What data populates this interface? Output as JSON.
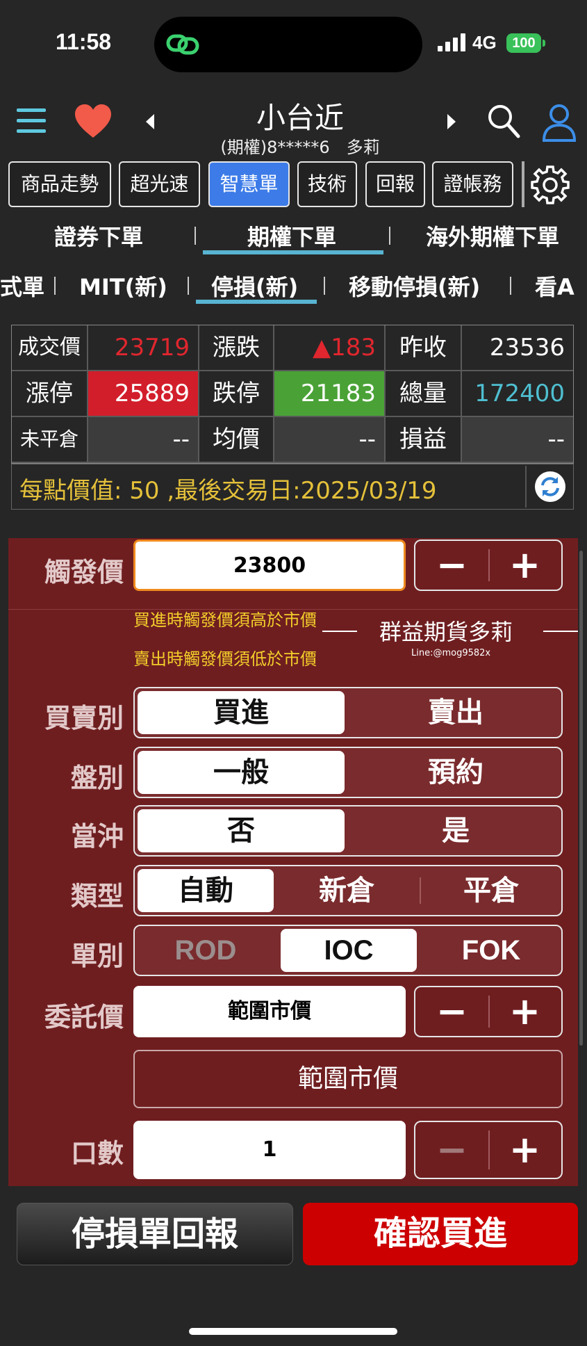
{
  "status": {
    "time": "11:58",
    "network": "4G",
    "battery": "100"
  },
  "header": {
    "title": "小台近",
    "subtitle": "(期權)8*****6　多莉",
    "icons": [
      "menu-icon",
      "heart-icon",
      "prev-icon",
      "next-icon",
      "search-icon",
      "user-icon",
      "gear-icon"
    ]
  },
  "func_buttons": [
    "商品走勢",
    "超光速",
    "智慧單",
    "技術",
    "回報",
    "證帳務"
  ],
  "tabs": {
    "level1": [
      "證券下單",
      "期權下單",
      "海外期權下單"
    ],
    "level2": [
      "式單",
      "MIT(新)",
      "停損(新)",
      "移動停損(新)",
      "看A"
    ]
  },
  "quote": {
    "r1": [
      "成交價",
      "23719",
      "漲跌",
      "▲183",
      "昨收",
      "23536"
    ],
    "r2": [
      "漲停",
      "25889",
      "跌停",
      "21183",
      "總量",
      "172400"
    ],
    "r3": [
      "未平倉",
      "--",
      "均價",
      "--",
      "損益",
      "--"
    ]
  },
  "info": {
    "text": "每點價值: 50 ,最後交易日:2025/03/19"
  },
  "form": {
    "trigger": {
      "label": "觸發價",
      "value": "23800"
    },
    "hints": [
      "買進時觸發價須高於市價",
      "賣出時觸發價須低於市價"
    ],
    "watermark": {
      "name": "群益期貨多莉",
      "line": "Line:@mog9582x"
    },
    "side": {
      "label": "買賣別",
      "options": [
        "買進",
        "賣出"
      ]
    },
    "session": {
      "label": "盤別",
      "options": [
        "一般",
        "預約"
      ]
    },
    "daytrade": {
      "label": "當沖",
      "options": [
        "否",
        "是"
      ]
    },
    "type": {
      "label": "類型",
      "options": [
        "自動",
        "新倉",
        "平倉"
      ]
    },
    "order": {
      "label": "單別",
      "options": [
        "ROD",
        "IOC",
        "FOK"
      ]
    },
    "price": {
      "label": "委託價",
      "value": "範圍市價",
      "range_text": "範圍市價"
    },
    "qty": {
      "label": "口數",
      "value": "1"
    },
    "stepper": {
      "minus": "−",
      "plus": "+"
    }
  },
  "bottom": {
    "report": "停損單回報",
    "confirm": "確認買進"
  },
  "colors": {
    "panel": "#6f1e20",
    "accent_blue": "#3c7be8",
    "limit_up": "#d21e2b",
    "limit_down": "#4aa236",
    "confirm": "#cc0000"
  }
}
